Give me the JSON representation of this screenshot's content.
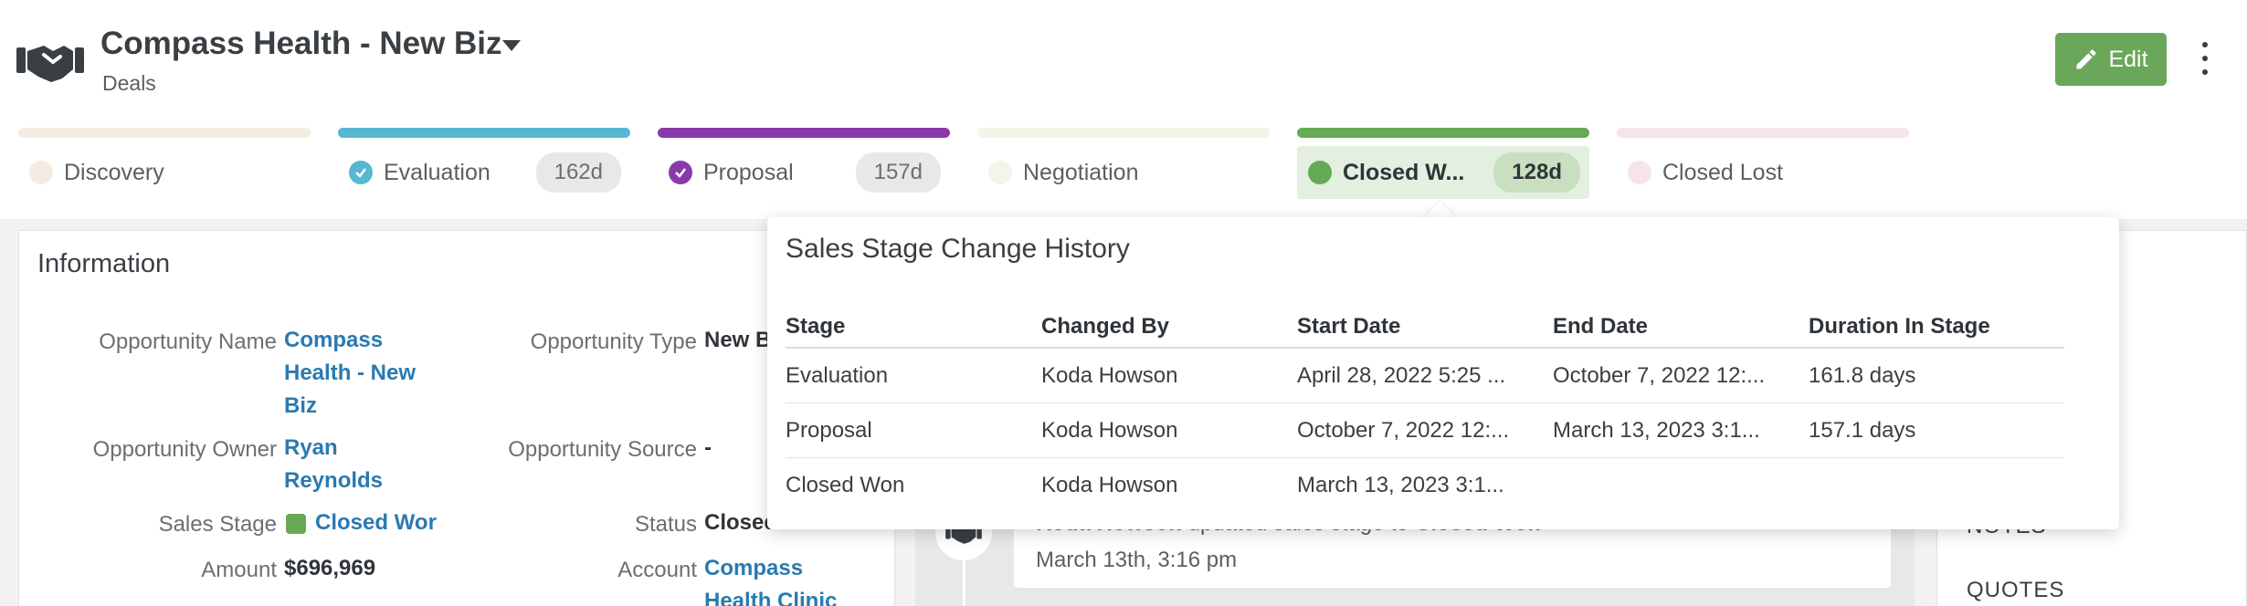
{
  "header": {
    "title": "Compass Health - New Biz",
    "subtitle": "Deals",
    "edit_label": "Edit"
  },
  "colors": {
    "accent_green": "#6aa75a",
    "link_blue": "#2a7ab0",
    "evaluation": "#56b7d0",
    "proposal": "#8a3aa8",
    "closed_won": "#66aa55"
  },
  "stages": [
    {
      "label": "Discovery",
      "days": ""
    },
    {
      "label": "Evaluation",
      "days": "162d"
    },
    {
      "label": "Proposal",
      "days": "157d"
    },
    {
      "label": "Negotiation",
      "days": ""
    },
    {
      "label": "Closed W...",
      "days": "128d"
    },
    {
      "label": "Closed Lost",
      "days": ""
    }
  ],
  "info": {
    "heading": "Information",
    "opportunity_name_label": "Opportunity Name",
    "opportunity_name_value": "Compass Health - New Biz",
    "opportunity_owner_label": "Opportunity Owner",
    "opportunity_owner_value": "Ryan Reynolds",
    "sales_stage_label": "Sales Stage",
    "sales_stage_value": "Closed Wor",
    "amount_label": "Amount",
    "amount_value": "$696,969",
    "opportunity_type_label": "Opportunity Type",
    "opportunity_type_value": "New B",
    "opportunity_source_label": "Opportunity Source",
    "opportunity_source_value": "-",
    "status_label": "Status",
    "status_value": "Closed",
    "account_label": "Account",
    "account_value": "Compass Health Clinic"
  },
  "activity": {
    "actor": "Koda Howson",
    "action": " updated sales stage to ",
    "target": "Closed Won",
    "time": "March 13th, 3:16 pm"
  },
  "right_panel": {
    "items": [
      "NOTES",
      "QUOTES"
    ]
  },
  "history": {
    "title": "Sales Stage Change History",
    "columns": [
      "Stage",
      "Changed By",
      "Start Date",
      "End Date",
      "Duration In Stage"
    ],
    "rows": [
      [
        "Evaluation",
        "Koda Howson",
        "April 28, 2022 5:25 ...",
        "October 7, 2022 12:...",
        "161.8 days"
      ],
      [
        "Proposal",
        "Koda Howson",
        "October 7, 2022 12:...",
        "March 13, 2023 3:1...",
        "157.1 days"
      ],
      [
        "Closed Won",
        "Koda Howson",
        "March 13, 2023 3:1...",
        "",
        ""
      ]
    ]
  }
}
